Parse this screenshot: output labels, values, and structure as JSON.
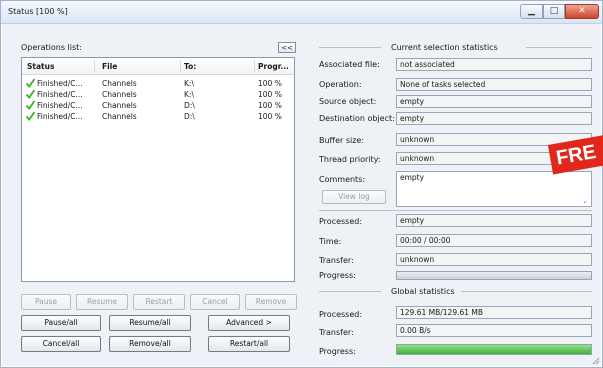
{
  "window": {
    "title": "Status [100 %]",
    "controls": {
      "minimize": "▁",
      "maximize": "□",
      "close": "✕"
    }
  },
  "operations": {
    "label": "Operations list:",
    "collapse_label": "<<",
    "columns": [
      "Status",
      "File",
      "To:",
      "Progr..."
    ],
    "rows": [
      {
        "status": "Finished/C...",
        "file": "Channels",
        "to": "K:\\",
        "progress": "100 %"
      },
      {
        "status": "Finished/C...",
        "file": "Channels",
        "to": "K:\\",
        "progress": "100 %"
      },
      {
        "status": "Finished/C...",
        "file": "Channels",
        "to": "D:\\",
        "progress": "100 %"
      },
      {
        "status": "Finished/C...",
        "file": "Channels",
        "to": "D:\\",
        "progress": "100 %"
      }
    ]
  },
  "controls": {
    "row1": [
      "Pause",
      "Resume",
      "Restart",
      "Cancel",
      "Remove"
    ],
    "row2": [
      "Pause/all",
      "Resume/all",
      "Advanced >"
    ],
    "row3": [
      "Cancel/all",
      "Remove/all",
      "Restart/all"
    ]
  },
  "current": {
    "header": "Current selection statistics",
    "associated_file": {
      "label": "Associated file:",
      "value": "not associated"
    },
    "operation": {
      "label": "Operation:",
      "value": "None of tasks selected"
    },
    "source": {
      "label": "Source object:",
      "value": "empty"
    },
    "destination": {
      "label": "Destination object:",
      "value": "empty"
    },
    "buffer": {
      "label": "Buffer size:",
      "value": "unknown"
    },
    "priority": {
      "label": "Thread priority:",
      "value": "unknown"
    },
    "comments": {
      "label": "Comments:",
      "value": "empty"
    },
    "view_log": "View log",
    "processed": {
      "label": "Processed:",
      "value": "empty"
    },
    "time": {
      "label": "Time:",
      "value": "00:00 / 00:00"
    },
    "transfer": {
      "label": "Transfer:",
      "value": "unknown"
    },
    "progress": {
      "label": "Progress:",
      "fraction": 0
    }
  },
  "global": {
    "header": "Global statistics",
    "processed": {
      "label": "Processed:",
      "value": "129.61 MB/129.61 MB"
    },
    "transfer": {
      "label": "Transfer:",
      "value": "0.00 B/s"
    },
    "progress": {
      "label": "Progress:",
      "fraction": 1.0
    }
  },
  "badge": {
    "text": "FRE",
    "color": "#e1261c"
  },
  "colors": {
    "check": "#3fae2a",
    "progress_fill": "#3fb337"
  }
}
